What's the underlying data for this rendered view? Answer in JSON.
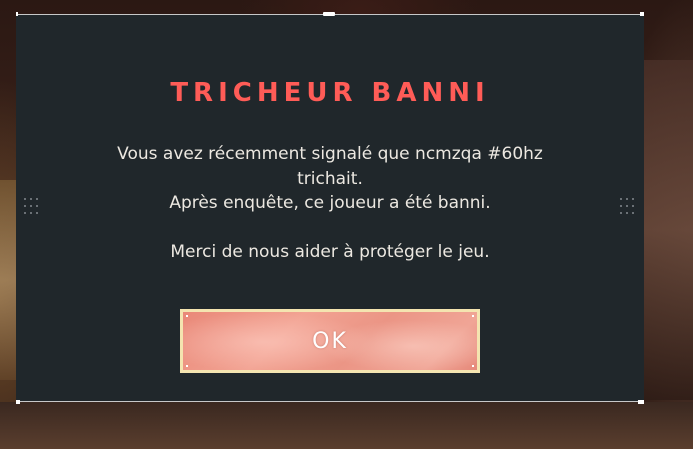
{
  "dialog": {
    "title": "TRICHEUR BANNI",
    "message_lines": [
      "Vous avez récemment signalé que ncmzqa #60hz",
      "trichait.",
      "Après enquête, ce joueur a été banni.",
      "Merci de nous aider à protéger le jeu."
    ],
    "ok_label": "OK"
  },
  "colors": {
    "panel_background": "#20272b",
    "title": "#ff5c57",
    "message_text": "#ece8e1",
    "button_fill": "#f0a596",
    "button_border": "#f4e4b0"
  }
}
